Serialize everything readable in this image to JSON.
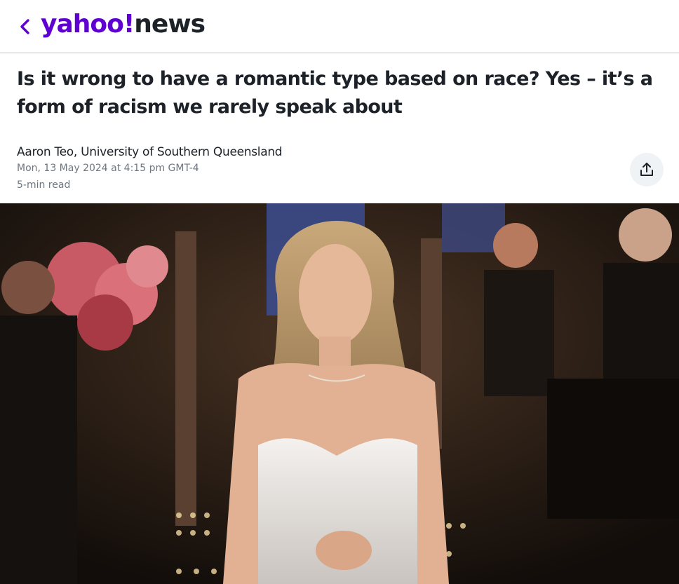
{
  "header": {
    "back_icon": "chevron-left-icon",
    "logo_yahoo": "yahoo!",
    "logo_news": "news"
  },
  "article": {
    "headline": "Is it wrong to have a romantic type based on race? Yes – it’s a form of racism we rarely speak about",
    "author": "Aaron Teo, University of Southern Queensland",
    "date": "Mon, 13 May 2024 at 4:15 pm GMT-4",
    "read_time": "5-min read",
    "share_icon": "share-icon"
  },
  "colors": {
    "brand": "#5f01d1",
    "text": "#1d2228",
    "meta": "#6e7780",
    "divider": "#c9b8e8"
  }
}
